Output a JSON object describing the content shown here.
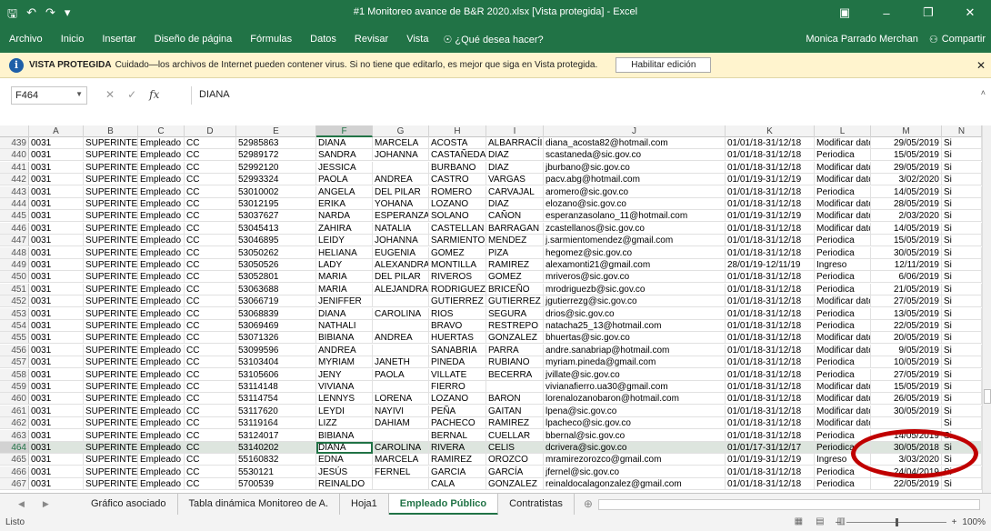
{
  "window": {
    "title": "#1 Monitoreo avance de B&R 2020.xlsx  [Vista protegida] - Excel",
    "user": "Monica Parrado Merchan",
    "share": "Compartir"
  },
  "ribbon": {
    "tabs": [
      "Archivo",
      "Inicio",
      "Insertar",
      "Diseño de página",
      "Fórmulas",
      "Datos",
      "Revisar",
      "Vista"
    ],
    "tell_me": "¿Qué desea hacer?"
  },
  "protected": {
    "label": "VISTA PROTEGIDA",
    "message": "Cuidado—los archivos de Internet pueden contener virus. Si no tiene que editarlo, es mejor que siga en Vista protegida.",
    "enable_button": "Habilitar edición"
  },
  "formula_bar": {
    "name_box": "F464",
    "formula": "DIANA"
  },
  "columns": [
    "A",
    "B",
    "C",
    "D",
    "E",
    "F",
    "G",
    "H",
    "I",
    "J",
    "K",
    "L",
    "M",
    "N"
  ],
  "selected_column": "F",
  "rows": [
    [
      "439",
      "0031",
      "SUPERINTEI",
      "Empleado Pú",
      "CC",
      "52985863",
      "DIANA",
      "MARCELA",
      "ACOSTA",
      "ALBARRACÍI",
      "diana_acosta82@hotmail.com",
      "01/01/18-31/12/18",
      "Modificar datc",
      "29/05/2019",
      "Si"
    ],
    [
      "440",
      "0031",
      "SUPERINTEI",
      "Empleado Pú",
      "CC",
      "52989172",
      "SANDRA",
      "JOHANNA",
      "CASTAÑEDA",
      "DIAZ",
      "scastaneda@sic.gov.co",
      "01/01/18-31/12/18",
      "Periodica",
      "15/05/2019",
      "Si"
    ],
    [
      "441",
      "0031",
      "SUPERINTEI",
      "Empleado Pú",
      "CC",
      "52992120",
      "JESSICA",
      "",
      "BURBANO",
      "DIAZ",
      "jburbano@sic.gov.co",
      "01/01/18-31/12/18",
      "Modificar datc",
      "29/05/2019",
      "Si"
    ],
    [
      "442",
      "0031",
      "SUPERINTEI",
      "Empleado Pú",
      "CC",
      "52993324",
      "PAOLA",
      "ANDREA",
      "CASTRO",
      "VARGAS",
      "pacv.abg@hotmail.com",
      "01/01/19-31/12/19",
      "Modificar datc",
      "3/02/2020",
      "Si"
    ],
    [
      "443",
      "0031",
      "SUPERINTEI",
      "Empleado Pú",
      "CC",
      "53010002",
      "ANGELA",
      "DEL PILAR",
      "ROMERO",
      "CARVAJAL",
      "aromero@sic.gov.co",
      "01/01/18-31/12/18",
      "Periodica",
      "14/05/2019",
      "Si"
    ],
    [
      "444",
      "0031",
      "SUPERINTEI",
      "Empleado Pú",
      "CC",
      "53012195",
      "ERIKA",
      "YOHANA",
      "LOZANO",
      "DIAZ",
      "elozano@sic.gov.co",
      "01/01/18-31/12/18",
      "Modificar datc",
      "28/05/2019",
      "Si"
    ],
    [
      "445",
      "0031",
      "SUPERINTEI",
      "Empleado Pú",
      "CC",
      "53037627",
      "NARDA",
      "ESPERANZA",
      "SOLANO",
      "CAÑON",
      "esperanzasolano_11@hotmail.com",
      "01/01/19-31/12/19",
      "Modificar datc",
      "2/03/2020",
      "Si"
    ],
    [
      "446",
      "0031",
      "SUPERINTEI",
      "Empleado Pú",
      "CC",
      "53045413",
      "ZAHIRA",
      "NATALIA",
      "CASTELLAN",
      "BARRAGAN",
      "zcastellanos@sic.gov.co",
      "01/01/18-31/12/18",
      "Modificar datc",
      "14/05/2019",
      "Si"
    ],
    [
      "447",
      "0031",
      "SUPERINTEI",
      "Empleado Pú",
      "CC",
      "53046895",
      "LEIDY",
      "JOHANNA",
      "SARMIENTO",
      "MENDEZ",
      "j.sarmientomendez@gmail.com",
      "01/01/18-31/12/18",
      "Periodica",
      "15/05/2019",
      "Si"
    ],
    [
      "448",
      "0031",
      "SUPERINTEI",
      "Empleado Pú",
      "CC",
      "53050262",
      "HELIANA",
      "EUGENIA",
      "GOMEZ",
      "PIZA",
      "hegomez@sic.gov.co",
      "01/01/18-31/12/18",
      "Periodica",
      "30/05/2019",
      "Si"
    ],
    [
      "449",
      "0031",
      "SUPERINTEI",
      "Empleado Pú",
      "CC",
      "53050526",
      "LADY",
      "ALEXANDRA",
      "MONTILLA",
      "RAMIREZ",
      "alexamonti21@gmail.com",
      "28/01/19-12/11/19",
      "Ingreso",
      "12/11/2019",
      "Si"
    ],
    [
      "450",
      "0031",
      "SUPERINTEI",
      "Empleado Pú",
      "CC",
      "53052801",
      "MARIA",
      "DEL PILAR",
      "RIVEROS",
      "GOMEZ",
      "mriveros@sic.gov.co",
      "01/01/18-31/12/18",
      "Periodica",
      "6/06/2019",
      "Si"
    ],
    [
      "451",
      "0031",
      "SUPERINTEI",
      "Empleado Pú",
      "CC",
      "53063688",
      "MARIA",
      "ALEJANDRA",
      "RODRIGUEZ",
      "BRICEÑO",
      "mrodriguezb@sic.gov.co",
      "01/01/18-31/12/18",
      "Periodica",
      "21/05/2019",
      "Si"
    ],
    [
      "452",
      "0031",
      "SUPERINTEI",
      "Empleado Pú",
      "CC",
      "53066719",
      "JENIFFER",
      "",
      "GUTIERREZ",
      "GUTIERREZ",
      "jgutierrezg@sic.gov.co",
      "01/01/18-31/12/18",
      "Modificar datc",
      "27/05/2019",
      "Si"
    ],
    [
      "453",
      "0031",
      "SUPERINTEI",
      "Empleado Pú",
      "CC",
      "53068839",
      "DIANA",
      "CAROLINA",
      "RIOS",
      "SEGURA",
      "drios@sic.gov.co",
      "01/01/18-31/12/18",
      "Periodica",
      "13/05/2019",
      "Si"
    ],
    [
      "454",
      "0031",
      "SUPERINTEI",
      "Empleado Pú",
      "CC",
      "53069469",
      "NATHALI",
      "",
      "BRAVO",
      "RESTREPO",
      "natacha25_13@hotmail.com",
      "01/01/18-31/12/18",
      "Periodica",
      "22/05/2019",
      "Si"
    ],
    [
      "455",
      "0031",
      "SUPERINTEI",
      "Empleado Pú",
      "CC",
      "53071326",
      "BIBIANA",
      "ANDREA",
      "HUERTAS",
      "GONZALEZ",
      "bhuertas@sic.gov.co",
      "01/01/18-31/12/18",
      "Modificar datc",
      "20/05/2019",
      "Si"
    ],
    [
      "456",
      "0031",
      "SUPERINTEI",
      "Empleado Pú",
      "CC",
      "53099596",
      "ANDREA",
      "",
      "SANABRIA",
      "PARRA",
      "andre.sanabriap@hotmail.com",
      "01/01/18-31/12/18",
      "Modificar datc",
      "9/05/2019",
      "Si"
    ],
    [
      "457",
      "0031",
      "SUPERINTEI",
      "Empleado Pú",
      "CC",
      "53103404",
      "MYRIAM",
      "JANETH",
      "PINEDA",
      "RUBIANO",
      "myriam.pineda@gmail.com",
      "01/01/18-31/12/18",
      "Periodica",
      "10/05/2019",
      "Si"
    ],
    [
      "458",
      "0031",
      "SUPERINTEI",
      "Empleado Pú",
      "CC",
      "53105606",
      "JENY",
      "PAOLA",
      "VILLATE",
      "BECERRA",
      "jvillate@sic.gov.co",
      "01/01/18-31/12/18",
      "Periodica",
      "27/05/2019",
      "Si"
    ],
    [
      "459",
      "0031",
      "SUPERINTEI",
      "Empleado Pú",
      "CC",
      "53114148",
      "VIVIANA",
      "",
      "FIERRO",
      "",
      "vivianafierro.ua30@gmail.com",
      "01/01/18-31/12/18",
      "Modificar datc",
      "15/05/2019",
      "Si"
    ],
    [
      "460",
      "0031",
      "SUPERINTEI",
      "Empleado Pú",
      "CC",
      "53114754",
      "LENNYS",
      "LORENA",
      "LOZANO",
      "BARON",
      "lorenalozanobaron@hotmail.com",
      "01/01/18-31/12/18",
      "Modificar datc",
      "26/05/2019",
      "Si"
    ],
    [
      "461",
      "0031",
      "SUPERINTEI",
      "Empleado Pú",
      "CC",
      "53117620",
      "LEYDI",
      "NAYIVI",
      "PEÑA",
      "GAITAN",
      "lpena@sic.gov.co",
      "01/01/18-31/12/18",
      "Modificar datc",
      "30/05/2019",
      "Si"
    ],
    [
      "462",
      "0031",
      "SUPERINTEI",
      "Empleado Pú",
      "CC",
      "53119164",
      "LIZZ",
      "DAHIAM",
      "PACHECO",
      "RAMIREZ",
      "lpacheco@sic.gov.co",
      "01/01/18-31/12/18",
      "Modificar datc",
      "",
      "Si"
    ],
    [
      "463",
      "0031",
      "SUPERINTEI",
      "Empleado Pú",
      "CC",
      "53124017",
      "BIBIANA",
      "",
      "BERNAL",
      "CUELLAR",
      "bbernal@sic.gov.co",
      "01/01/18-31/12/18",
      "Periodica",
      "14/05/2019",
      "Si"
    ],
    [
      "464",
      "0031",
      "SUPERINTEI",
      "Empleado Pú",
      "CC",
      "53140202",
      "DIANA",
      "CAROLINA",
      "RIVERA",
      "CELIS",
      "dcrivera@sic.gov.co",
      "01/01/17-31/12/17",
      "Periodica",
      "30/05/2018",
      "Si"
    ],
    [
      "465",
      "0031",
      "SUPERINTEI",
      "Empleado Pú",
      "CC",
      "55160832",
      "EDNA",
      "MARCELA",
      "RAMIREZ",
      "OROZCO",
      "mramirezorozco@gmail.com",
      "01/01/19-31/12/19",
      "Ingreso",
      "3/03/2020",
      "Si"
    ],
    [
      "466",
      "0031",
      "SUPERINTEI",
      "Empleado Pú",
      "CC",
      "5530121",
      "JESÚS",
      "FERNEL",
      "GARCIA",
      "GARCÍA",
      "jfernel@sic.gov.co",
      "01/01/18-31/12/18",
      "Periodica",
      "24/04/2019",
      "Si"
    ],
    [
      "467",
      "0031",
      "SUPERINTEI",
      "Empleado Pú",
      "CC",
      "5700539",
      "REINALDO",
      "",
      "CALA",
      "GONZALEZ",
      "reinaldocalagonzalez@gmail.com",
      "01/01/18-31/12/18",
      "Periodica",
      "22/05/2019",
      "Si"
    ]
  ],
  "selected_row": "464",
  "sheets": [
    "Gráfico asociado",
    "Tabla dinámica Monitoreo de A.",
    "Hoja1",
    "Empleado Público",
    "Contratistas"
  ],
  "active_sheet": "Empleado Público",
  "status": {
    "ready": "Listo",
    "zoom": "100%"
  }
}
